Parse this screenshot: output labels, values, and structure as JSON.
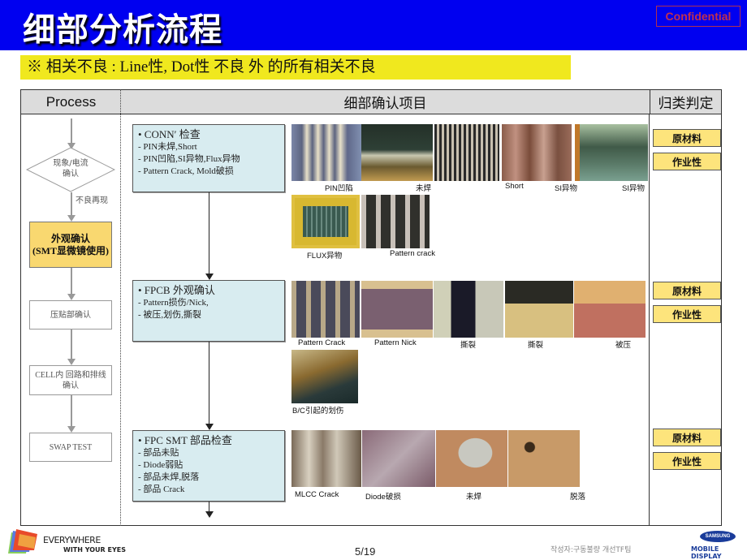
{
  "header": {
    "title": "细部分析流程",
    "confidential": "Confidential"
  },
  "note": "※ 相关不良 : Line性, Dot性 不良 外 的所有相关不良",
  "table": {
    "headers": {
      "process": "Process",
      "detail": "细部确认项目",
      "judge": "归类判定"
    }
  },
  "process_flow": {
    "decision": "现象/电流\n确认",
    "repro_label": "不良再现",
    "steps": [
      "外观确认\n(SMT显微镜使用)",
      "压贴部确认",
      "CELL内 回路和排线确认",
      "SWAP TEST"
    ]
  },
  "sections": [
    {
      "title": "• CONN′ 检查",
      "items": [
        "- PIN未焊,Short",
        "- PIN凹陷,SI异物,Flux异物",
        "- Pattern Crack, Mold破损"
      ],
      "captions": [
        "PIN凹陷",
        "未焊",
        "Short",
        "SI异物",
        "SI异物",
        "FLUX异物",
        "Pattern crack"
      ],
      "judgements": [
        "原材料",
        "作业性"
      ]
    },
    {
      "title": "• FPCB 外观确认",
      "items": [
        "- Pattern损伤/Nick,",
        "- 被压,划伤,撕裂"
      ],
      "captions": [
        "Pattern  Crack",
        "Pattern  Nick",
        "撕裂",
        "撕裂",
        "被压",
        "B/C引起的划伤"
      ],
      "judgements": [
        "原材料",
        "作业性"
      ]
    },
    {
      "title": "• FPC SMT 部品检查",
      "items": [
        "- 部品未贴",
        "- Diode弱贴",
        "- 部品未焊,脱落",
        "- 部品 Crack"
      ],
      "captions": [
        "MLCC Crack",
        "Diode破损",
        "未焊",
        "脱落"
      ],
      "judgements": [
        "原材料",
        "作业性"
      ]
    }
  ],
  "photos": {
    "s1": [
      "pcb-pin-dent-photo",
      "pcb-unsoldered-photo",
      "pcb-short-photo",
      "pcb-si-foreign-photo",
      "pcb-si-foreign-photo-2",
      "pcb-flux-foreign-photo",
      "pcb-pattern-crack-photo"
    ],
    "colors": {
      "accent_header": "#0000f0",
      "note_bg": "#f0e81e",
      "detail_box_bg": "#d8ecf0",
      "judge_bg": "#fde47c",
      "visual_step_bg": "#f9d870"
    }
  },
  "footer": {
    "slogan_line1": "EVERYWHERE",
    "slogan_line2": "WITH YOUR EYES",
    "page": "5/19",
    "author": "작성자:구동불량 개선TF팀",
    "brand": "SAMSUNG",
    "brand_sub": "MOBILE DISPLAY"
  }
}
